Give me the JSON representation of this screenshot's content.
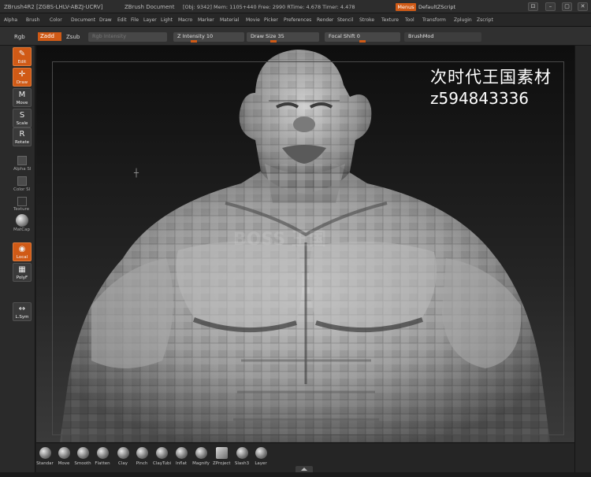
{
  "titlebar": {
    "app": "ZBrush4R2 [ZGBS-LHLV-ABZJ-UCRV]",
    "document": "ZBrush Document",
    "stats": "[Obj: 9342] Mem: 1105+440 Free: 2990 RTime: 4.678 Timer: 4.478",
    "menus_label": "Menus",
    "script_label": "DefaultZScript"
  },
  "menubar": [
    "Alpha",
    "Brush",
    "Color",
    "Document",
    "Draw",
    "Edit",
    "File",
    "Layer",
    "Light",
    "Macro",
    "Marker",
    "Material",
    "Movie",
    "Picker",
    "Preferences",
    "Render",
    "Stencil",
    "Stroke",
    "Texture",
    "Tool",
    "Transform",
    "Zplugin",
    "Zscript"
  ],
  "shelf": {
    "rgb": "Rgb",
    "zadd": "Zadd",
    "zsub": "Zsub",
    "rgb_intensity": "Rgb Intensity",
    "z_intensity": "Z Intensity 10",
    "draw_size": "Draw Size 35",
    "focal_shift": "Focal Shift 0",
    "brushmod": "BrushMod"
  },
  "lefttray": {
    "edit": "Edit",
    "draw": "Draw",
    "move": "Move",
    "scale": "Scale",
    "rotate": "Rotate",
    "alpha": "Alpha Sl",
    "color": "Color Sl",
    "texture": "Texture",
    "matcap": "MatCap",
    "local": "Local",
    "polyf": "PolyF",
    "lsym": "L.Sym"
  },
  "viewport": {
    "watermark_cn": "次时代王国素材",
    "watermark_id": "z594843336",
    "ghost_text": "BOSS 王国"
  },
  "brushes": [
    "Standar",
    "Move",
    "Smooth",
    "Flatten",
    "Clay",
    "Pinch",
    "ClayTubi",
    "Inflat",
    "Magnify",
    "ZProject",
    "Slash3",
    "Layer"
  ]
}
